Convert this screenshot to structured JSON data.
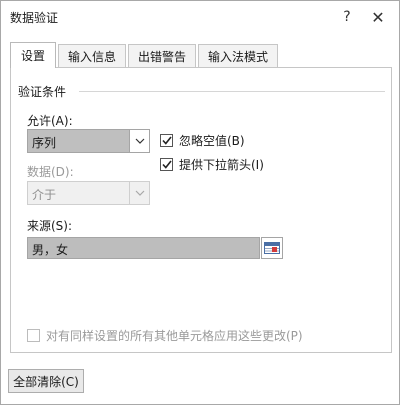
{
  "window": {
    "title": "数据验证",
    "help_glyph": "?",
    "close_glyph": "✕"
  },
  "tabs": [
    {
      "label": "设置",
      "active": true
    },
    {
      "label": "输入信息",
      "active": false
    },
    {
      "label": "出错警告",
      "active": false
    },
    {
      "label": "输入法模式",
      "active": false
    }
  ],
  "settings": {
    "section_title": "验证条件",
    "allow_label": "允许(A):",
    "allow_value": "序列",
    "data_label": "数据(D):",
    "data_value": "介于",
    "ignore_blank_label": "忽略空值(B)",
    "ignore_blank_checked": true,
    "dropdown_label": "提供下拉箭头(I)",
    "dropdown_checked": true,
    "source_label": "来源(S):",
    "source_value": "男，女",
    "apply_all_label": "对有同样设置的所有其他单元格应用这些更改(P)",
    "apply_all_checked": false
  },
  "buttons": {
    "clear_all": "全部清除(C)"
  },
  "icons": {
    "dropdown": "chevron-down-icon",
    "range_select": "range-select-icon",
    "check": "check-icon"
  },
  "colors": {
    "selected_field": "#bfbfbf",
    "border": "#a5a5a5"
  }
}
